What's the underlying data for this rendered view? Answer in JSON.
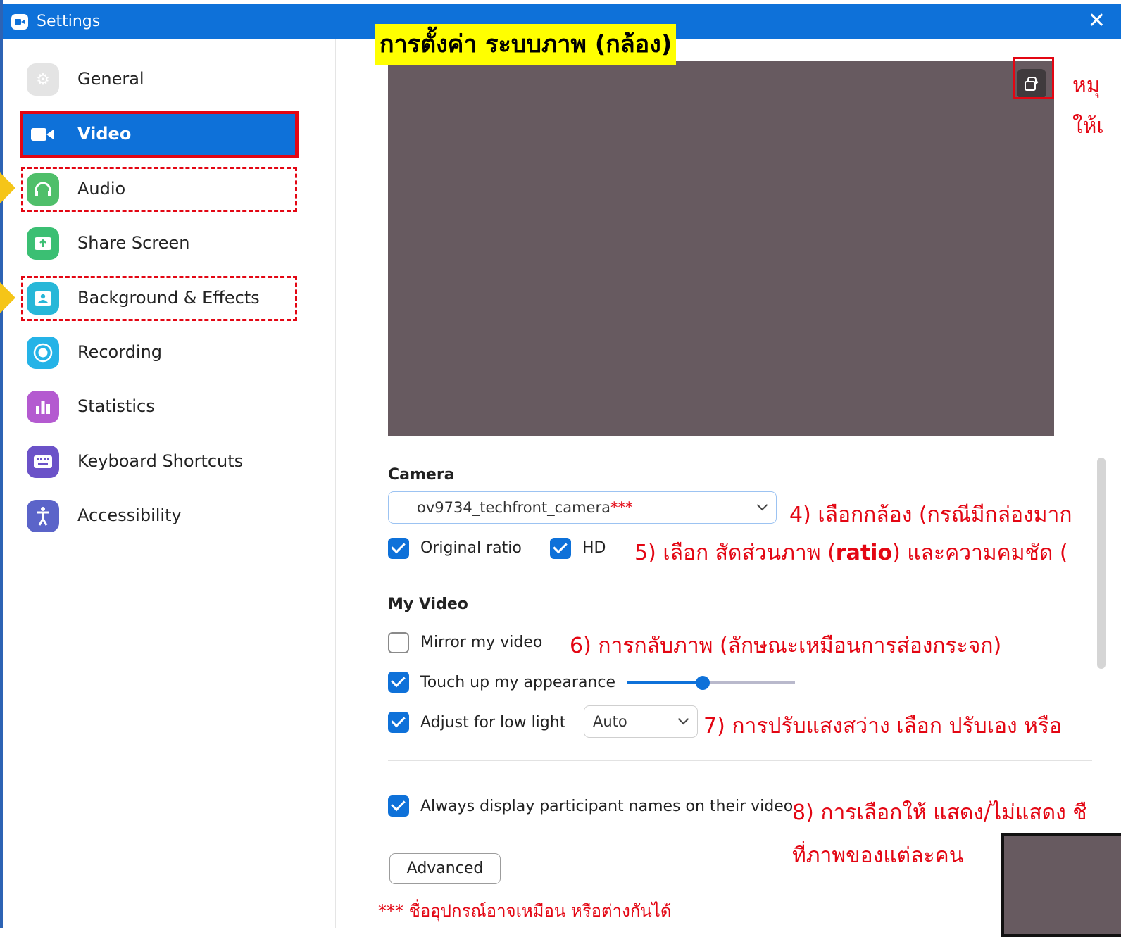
{
  "window": {
    "title": "Settings",
    "close": "✕"
  },
  "sidebar": {
    "items": [
      {
        "label": "General",
        "icon": "gear-icon",
        "color": "#e4e4e4"
      },
      {
        "label": "Video",
        "icon": "video-camera-icon",
        "color": "#ffffff"
      },
      {
        "label": "Audio",
        "icon": "headphones-icon",
        "color": "#4fbf6a"
      },
      {
        "label": "Share Screen",
        "icon": "share-screen-icon",
        "color": "#3bbf73"
      },
      {
        "label": "Background & Effects",
        "icon": "background-portrait-icon",
        "color": "#27b7d8"
      },
      {
        "label": "Recording",
        "icon": "record-icon",
        "color": "#25b3e7"
      },
      {
        "label": "Statistics",
        "icon": "bar-chart-icon",
        "color": "#b45ad0"
      },
      {
        "label": "Keyboard Shortcuts",
        "icon": "keyboard-icon",
        "color": "#6b52c8"
      },
      {
        "label": "Accessibility",
        "icon": "accessibility-icon",
        "color": "#5b64c9"
      }
    ]
  },
  "main": {
    "heading": "การตั้งค่า ระบบภาพ (กล้อง)",
    "camera_title": "Camera",
    "camera_select": "ov9734_techfront_camera",
    "camera_select_stars": "***",
    "original_ratio": "Original ratio",
    "hd": "HD",
    "my_video_title": "My Video",
    "mirror": "Mirror my video",
    "touch_up": "Touch up my appearance",
    "touch_up_level": 0.45,
    "low_light": "Adjust for low light",
    "low_light_mode": "Auto",
    "always_display": "Always display participant names on their video",
    "advanced": "Advanced"
  },
  "notes": {
    "rotate_1": "หมุ",
    "rotate_2": "ให้เ",
    "n4": "4) เลือกกล้อง (กรณีมีกล่องมาก",
    "n5_a": "5) เลือก สัดส่วนภาพ (",
    "n5_b": "ratio",
    "n5_c": ") และความคมชัด (",
    "n6": "6) การกลับภาพ (ลักษณะเหมือนการส่องกระจก)",
    "n7": "7) การปรับแสงสว่าง เลือก ปรับเอง หรือ",
    "n8": "8) การเลือกให้ แสดง/ไม่แสดง ชื",
    "n8b": "ที่ภาพของแต่ละคน",
    "footnote": "*** ชื่ออุปกรณ์อาจเหมือน หรือต่างกันได้"
  },
  "colors": {
    "accent": "#0e71d9",
    "annotation_red": "#e30613",
    "highlight": "#ffff00",
    "preview": "#675a60"
  }
}
